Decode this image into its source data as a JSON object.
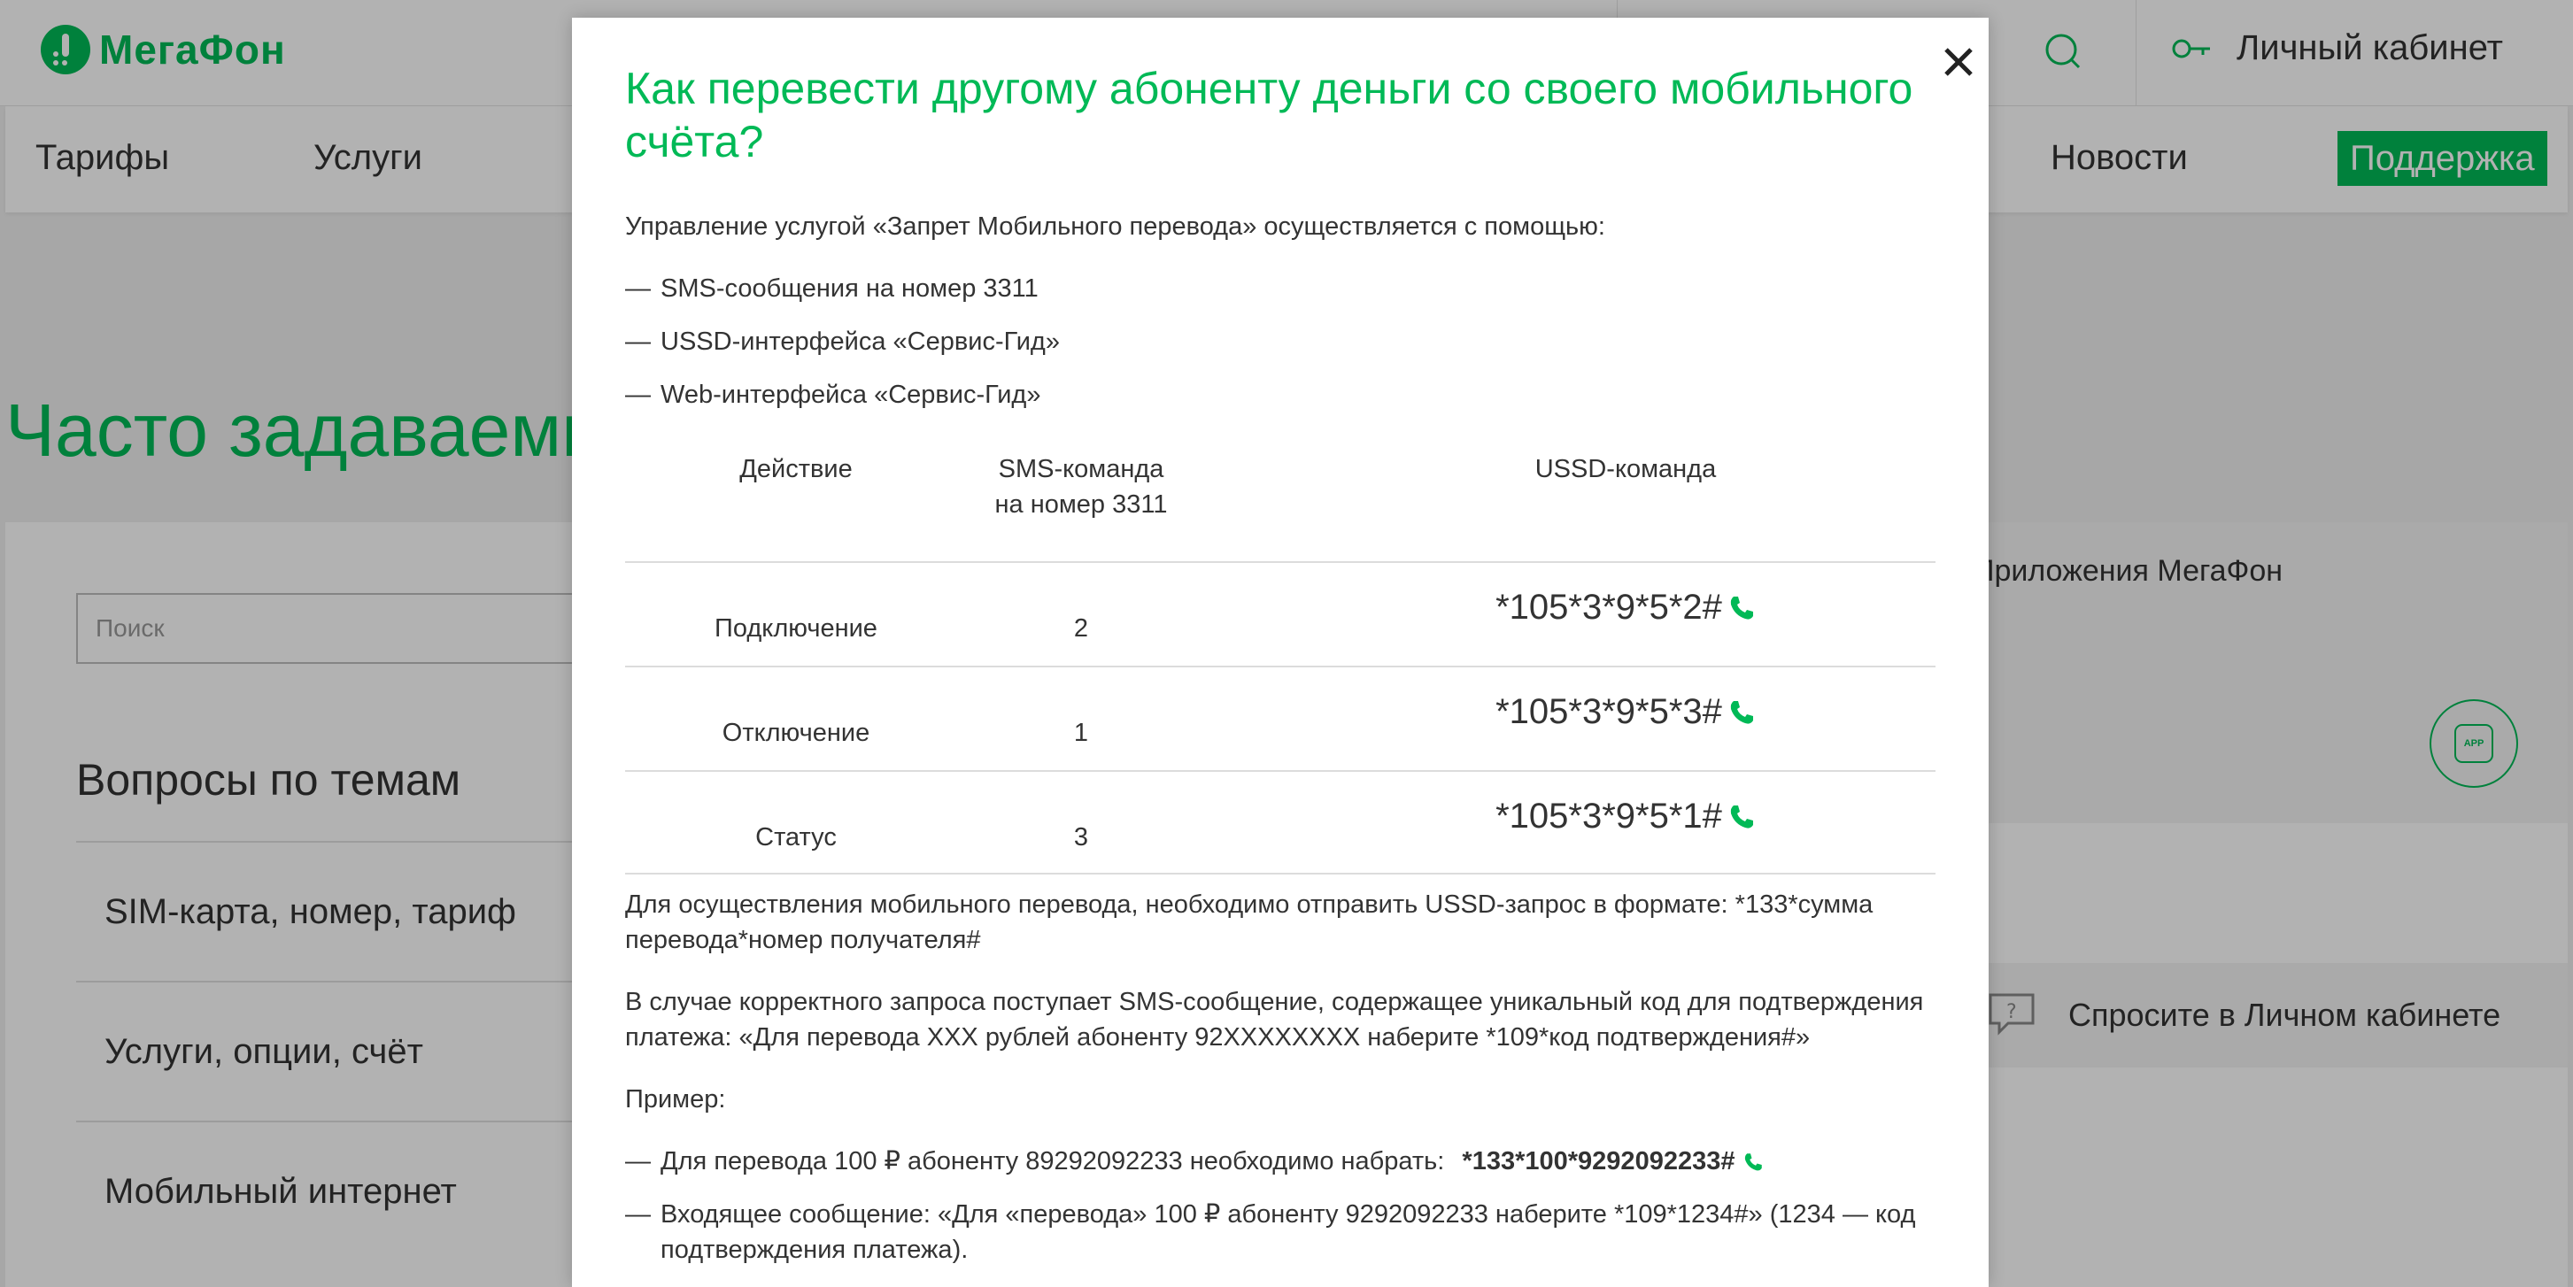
{
  "header": {
    "logo_text": "МегаФон",
    "cabinet_label": "Личный кабинет"
  },
  "nav": {
    "items": [
      "Тарифы",
      "Услуги",
      "Новости"
    ],
    "support_label": "Поддержка"
  },
  "faq": {
    "title": "Часто задаваемые вопросы",
    "search_placeholder": "Поиск",
    "topics_title": "Вопросы по темам",
    "topics": [
      "SIM-карта, номер, тариф",
      "Услуги, опции, счёт",
      "Мобильный интернет"
    ]
  },
  "sidebar": {
    "apps_label": "Приложения МегаФон",
    "app_badge": "APP",
    "ask_label": "Спросите в Личном кабинете"
  },
  "modal": {
    "title": "Как перевести другому абоненту деньги со своего мобильного счёта?",
    "intro": "Управление услугой «Запрет Мобильного перевода» осуществляется с помощью:",
    "methods": [
      "SMS-сообщения на номер 3311",
      "USSD-интерфейса «Сервис-Гид»",
      "Web-интерфейса «Сервис-Гид»"
    ],
    "table": {
      "headers": {
        "action": "Действие",
        "sms_line1": "SMS-команда",
        "sms_line2": "на номер 3311",
        "ussd": "USSD-команда"
      },
      "rows": [
        {
          "action": "Подключение",
          "sms": "2",
          "ussd": "*105*3*9*5*2#"
        },
        {
          "action": "Отключение",
          "sms": "1",
          "ussd": "*105*3*9*5*3#"
        },
        {
          "action": "Статус",
          "sms": "3",
          "ussd": "*105*3*9*5*1#"
        }
      ]
    },
    "transfer_format": "Для осуществления мобильного перевода, необходимо отправить USSD-запрос в формате: *133*сумма перевода*номер получателя#",
    "confirmation": "В случае корректного запроса поступает SMS-сообщение, содержащее уникальный код для подтверждения платежа: «Для перевода XXX рублей абоненту 92XXXXXXXX наберите *109*код подтверждения#»",
    "example_label": "Пример:",
    "example_1_text": "Для перевода 100 ₽ абоненту 89292092233 необходимо набрать:",
    "example_1_code": "*133*100*9292092233#",
    "example_2_text": "Входящее сообщение: «Для «перевода» 100 ₽ абоненту 9292092233 наберите *109*1234#» (1234 — код подтверждения платежа)."
  },
  "colors": {
    "brand_green": "#00b956",
    "text": "#333333",
    "overlay": "rgba(0,0,0,0.30)"
  },
  "icons": [
    "search-icon",
    "key-icon",
    "close-icon",
    "phone-icon",
    "chat-question-icon",
    "app-icon"
  ]
}
